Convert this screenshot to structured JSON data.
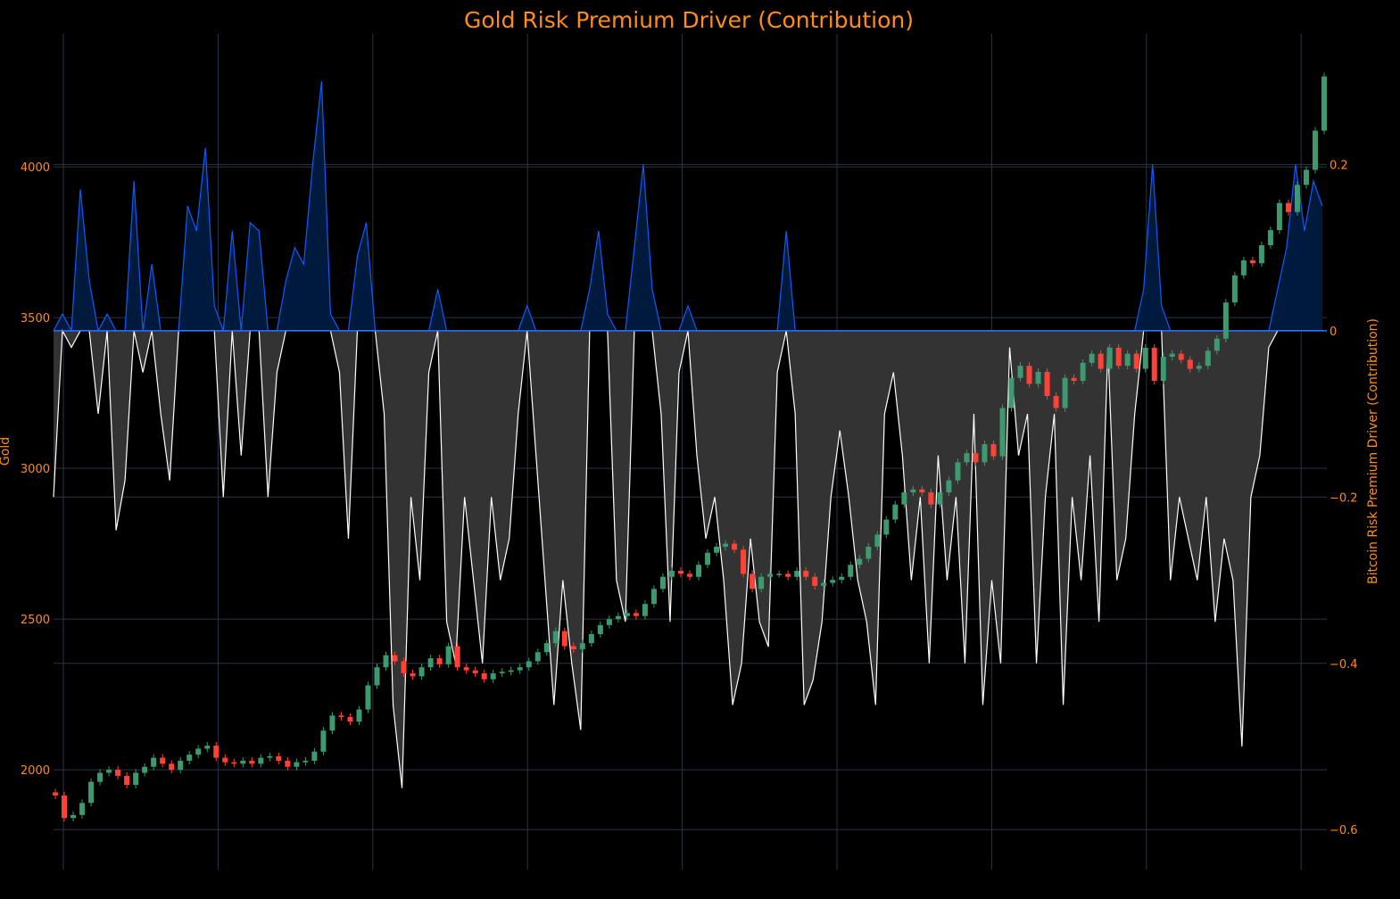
{
  "chart_data": {
    "type": "candlestick+area",
    "title": "Gold Risk Premium Driver (Contribution)",
    "ylabel_left": "Gold",
    "ylabel_right": "Bitcoin Risk Premium Driver (Contribution)",
    "ylim_left": [
      1669,
      4441
    ],
    "ylim_right": [
      -0.648,
      0.357
    ],
    "yticks_left": [
      2000,
      2500,
      3000,
      3500,
      4000
    ],
    "yticks_right": [
      0.2,
      0,
      -0.2,
      -0.4,
      -0.6
    ],
    "ytick_labels_right": [
      "0.2",
      "0",
      "−0.2",
      "−0.4",
      "−0.6"
    ],
    "xtick_count": 9,
    "grid": true,
    "colors": {
      "title": "#ff8c1a",
      "grid": "#2b3545",
      "up": "#3d9970",
      "down": "#ff4136",
      "positive_line": "#0a5cff",
      "positive_fill": "#001a3d",
      "negative_line": "#ffffff",
      "negative_fill": "#333333"
    },
    "gold_close": [
      1915,
      1840,
      1850,
      1890,
      1960,
      1990,
      2000,
      1980,
      1950,
      1990,
      2010,
      2040,
      2020,
      2000,
      2030,
      2050,
      2070,
      2080,
      2040,
      2025,
      2020,
      2030,
      2020,
      2040,
      2045,
      2030,
      2010,
      2025,
      2030,
      2060,
      2130,
      2180,
      2175,
      2160,
      2200,
      2280,
      2340,
      2380,
      2360,
      2320,
      2310,
      2340,
      2370,
      2350,
      2410,
      2340,
      2330,
      2320,
      2300,
      2320,
      2325,
      2330,
      2340,
      2360,
      2390,
      2420,
      2460,
      2410,
      2400,
      2420,
      2450,
      2480,
      2500,
      2510,
      2520,
      2510,
      2550,
      2600,
      2640,
      2660,
      2650,
      2640,
      2680,
      2720,
      2740,
      2750,
      2730,
      2650,
      2600,
      2640,
      2650,
      2650,
      2640,
      2660,
      2640,
      2610,
      2620,
      2630,
      2640,
      2680,
      2700,
      2740,
      2780,
      2830,
      2880,
      2920,
      2930,
      2920,
      2880,
      2920,
      2960,
      3020,
      3050,
      3020,
      3080,
      3040,
      3200,
      3300,
      3340,
      3280,
      3320,
      3240,
      3200,
      3300,
      3290,
      3350,
      3380,
      3330,
      3400,
      3340,
      3380,
      3330,
      3400,
      3290,
      3370,
      3380,
      3360,
      3330,
      3340,
      3390,
      3430,
      3550,
      3640,
      3690,
      3680,
      3740,
      3790,
      3880,
      3850,
      3940,
      3990,
      4120,
      4300
    ],
    "contribution": [
      -0.2,
      0.02,
      -0.02,
      0.17,
      0.06,
      -0.1,
      0.02,
      -0.24,
      -0.18,
      0.18,
      -0.05,
      0.08,
      -0.1,
      -0.18,
      0.0,
      0.15,
      0.12,
      0.22,
      0.03,
      -0.2,
      0.12,
      -0.15,
      0.13,
      0.12,
      -0.2,
      -0.05,
      0.06,
      0.1,
      0.08,
      0.2,
      0.3,
      0.02,
      -0.05,
      -0.25,
      0.09,
      0.13,
      0.0,
      -0.1,
      -0.45,
      -0.55,
      -0.2,
      -0.3,
      -0.05,
      0.05,
      -0.35,
      -0.4,
      -0.2,
      -0.3,
      -0.4,
      -0.2,
      -0.3,
      -0.25,
      -0.1,
      0.03,
      -0.15,
      -0.3,
      -0.45,
      -0.3,
      -0.4,
      -0.48,
      0.05,
      0.12,
      0.02,
      -0.3,
      -0.35,
      0.1,
      0.2,
      0.05,
      -0.1,
      -0.35,
      -0.05,
      0.03,
      -0.15,
      -0.25,
      -0.2,
      -0.3,
      -0.45,
      -0.4,
      -0.25,
      -0.35,
      -0.38,
      -0.05,
      0.12,
      -0.1,
      -0.45,
      -0.42,
      -0.35,
      -0.2,
      -0.12,
      -0.2,
      -0.3,
      -0.35,
      -0.45,
      -0.1,
      -0.05,
      -0.15,
      -0.3,
      -0.2,
      -0.4,
      -0.15,
      -0.3,
      -0.2,
      -0.4,
      -0.1,
      -0.45,
      -0.3,
      -0.4,
      -0.02,
      -0.15,
      -0.1,
      -0.4,
      -0.2,
      -0.1,
      -0.45,
      -0.2,
      -0.3,
      -0.15,
      -0.35,
      -0.02,
      -0.3,
      -0.25,
      -0.1,
      0.05,
      0.2,
      0.03,
      -0.3,
      -0.2,
      -0.25,
      -0.3,
      -0.2,
      -0.35,
      -0.25,
      -0.3,
      -0.5,
      -0.2,
      -0.15,
      -0.02,
      0.05,
      0.1,
      0.2,
      0.12,
      0.18,
      0.15
    ]
  }
}
